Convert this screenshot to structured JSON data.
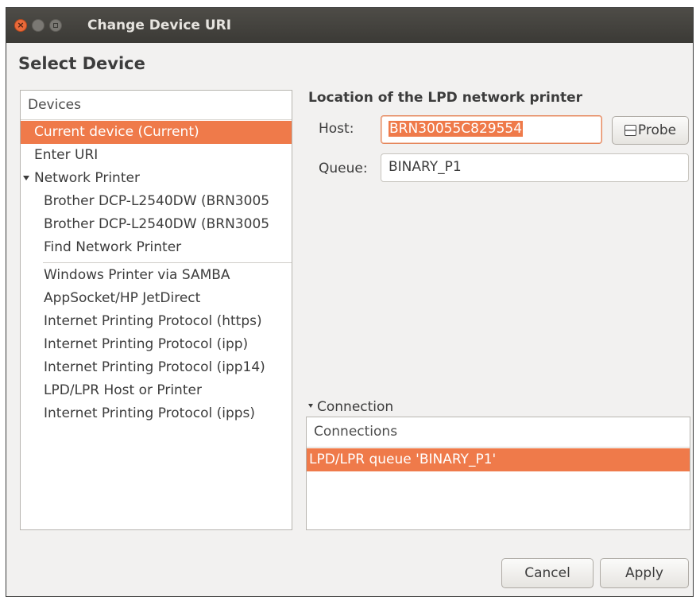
{
  "window": {
    "title": "Change Device URI",
    "close_glyph": "×"
  },
  "page": {
    "heading": "Select Device"
  },
  "devices": {
    "header": "Devices",
    "items": [
      {
        "label": "Current device (Current)"
      },
      {
        "label": "Enter URI"
      },
      {
        "label": "Network Printer"
      },
      {
        "label": "Brother DCP-L2540DW (BRN3005"
      },
      {
        "label": "Brother DCP-L2540DW (BRN3005"
      },
      {
        "label": "Find Network Printer"
      },
      {
        "label": "Windows Printer via SAMBA"
      },
      {
        "label": "AppSocket/HP JetDirect"
      },
      {
        "label": "Internet Printing Protocol (https)"
      },
      {
        "label": "Internet Printing Protocol (ipp)"
      },
      {
        "label": "Internet Printing Protocol (ipp14)"
      },
      {
        "label": "LPD/LPR Host or Printer"
      },
      {
        "label": "Internet Printing Protocol (ipps)"
      }
    ]
  },
  "lpd": {
    "title": "Location of the LPD network printer",
    "host_label": "Host:",
    "host_value": "BRN30055C829554",
    "probe_label": "Probe",
    "queue_label": "Queue:",
    "queue_value": "BINARY_P1"
  },
  "connection": {
    "expander_label": "Connection",
    "header": "Connections",
    "items": [
      {
        "label": "LPD/LPR queue 'BINARY_P1'"
      }
    ]
  },
  "buttons": {
    "cancel": "Cancel",
    "apply": "Apply"
  },
  "colors": {
    "selection": "#ef7a4a",
    "titlebar": "#3b3a36",
    "background": "#f2f1f0"
  }
}
